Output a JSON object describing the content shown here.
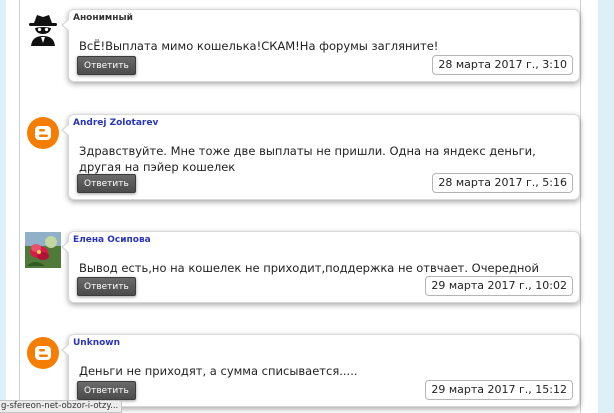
{
  "comments": [
    {
      "author": "Анонимный",
      "text": "ВсЁ!Выплата мимо кошелька!СКАМ!На форумы загляните!",
      "reply_label": "Ответить",
      "date": "28 марта 2017 г., 3:10",
      "avatar": "anonymous-spy-icon"
    },
    {
      "author": "Andrej Zolotarev",
      "text": "Здравствуйте. Мне тоже две выплаты не пришли. Одна на яндекс деньги, другая на пэйер кошелек",
      "reply_label": "Ответить",
      "date": "28 марта 2017 г., 5:16",
      "avatar": "blogger-icon"
    },
    {
      "author": "Елена Осипова",
      "text": "Вывод есть,но на кошелек не приходит,поддержка не отвчает. Очередной лохотрон",
      "reply_label": "Ответить",
      "date": "29 марта 2017 г., 10:02",
      "avatar": "flower-photo"
    },
    {
      "author": "Unknown",
      "text": "Деньги не приходят, а сумма списывается.....",
      "reply_label": "Ответить",
      "date": "29 марта 2017 г., 15:12",
      "avatar": "blogger-icon"
    }
  ],
  "status_bar": {
    "url": "g-sfereon-net-obzor-i-otzy..."
  },
  "colors": {
    "author_link": "#2a35b8",
    "blogger_orange": "#f57d00",
    "page_side": "#ddeff7"
  }
}
